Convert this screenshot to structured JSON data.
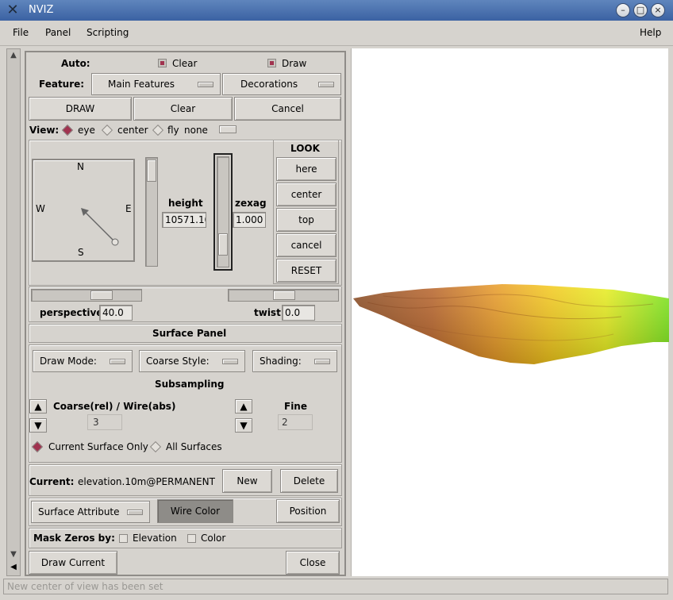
{
  "window": {
    "title": "NVIZ",
    "min": "–",
    "max": "□",
    "close": "×"
  },
  "menu": {
    "file": "File",
    "panel": "Panel",
    "scripting": "Scripting",
    "help": "Help"
  },
  "auto": {
    "label": "Auto:",
    "clear": "Clear",
    "draw": "Draw"
  },
  "feature": {
    "label": "Feature:",
    "main": "Main Features",
    "decorations": "Decorations"
  },
  "actions": {
    "draw": "DRAW",
    "clear": "Clear",
    "cancel": "Cancel"
  },
  "view": {
    "label": "View:",
    "eye": "eye",
    "center": "center",
    "fly": "fly",
    "none": "none"
  },
  "compass": {
    "n": "N",
    "s": "S",
    "e": "E",
    "w": "W"
  },
  "height": {
    "label": "height",
    "value": "10571.10"
  },
  "zexag": {
    "label": "zexag",
    "value": "1.000"
  },
  "look": {
    "title": "LOOK",
    "here": "here",
    "center": "center",
    "top": "top",
    "cancel": "cancel",
    "reset": "RESET"
  },
  "perspective": {
    "label": "perspective",
    "value": "40.0"
  },
  "twist": {
    "label": "twist",
    "value": "0.0"
  },
  "surface": {
    "title": "Surface Panel",
    "draw_mode": "Draw Mode:",
    "coarse_style": "Coarse Style:",
    "shading": "Shading:",
    "subsampling": "Subsampling",
    "coarse_label": "Coarse(rel) / Wire(abs)",
    "coarse_value": "3",
    "fine_label": "Fine",
    "fine_value": "2",
    "current_only": "Current Surface Only",
    "all_surfaces": "All Surfaces",
    "current_label": "Current:",
    "current_value": "elevation.10m@PERMANENT",
    "new": "New",
    "delete": "Delete",
    "attribute": "Surface Attribute",
    "wire_color": "Wire Color",
    "position": "Position",
    "mask_label": "Mask Zeros by:",
    "mask_elev": "Elevation",
    "mask_color": "Color",
    "draw_current": "Draw Current",
    "close": "Close"
  },
  "status": "New center of view has been set"
}
